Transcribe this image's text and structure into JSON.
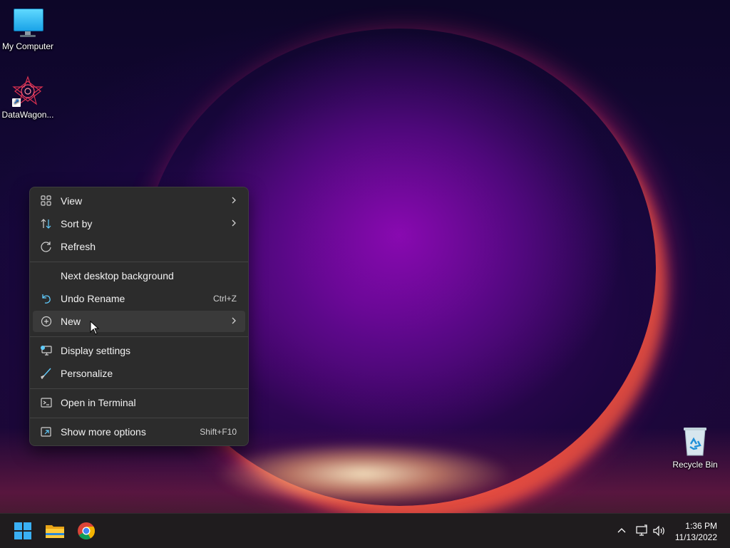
{
  "desktop": {
    "icons": [
      {
        "label": "My Computer"
      },
      {
        "label": "DataWagon..."
      },
      {
        "label": "Recycle Bin"
      }
    ]
  },
  "context_menu": {
    "items": [
      {
        "label": "View",
        "icon": "grid-icon",
        "submenu": true
      },
      {
        "label": "Sort by",
        "icon": "sort-icon",
        "submenu": true
      },
      {
        "label": "Refresh",
        "icon": "refresh-icon"
      },
      {
        "label": "Next desktop background"
      },
      {
        "label": "Undo Rename",
        "icon": "undo-icon",
        "shortcut": "Ctrl+Z"
      },
      {
        "label": "New",
        "icon": "new-plus-icon",
        "submenu": true,
        "highlighted": true
      },
      {
        "label": "Display settings",
        "icon": "display-settings-icon"
      },
      {
        "label": "Personalize",
        "icon": "brush-icon"
      },
      {
        "label": "Open in Terminal",
        "icon": "terminal-icon"
      },
      {
        "label": "Show more options",
        "icon": "more-options-icon",
        "shortcut": "Shift+F10"
      }
    ]
  },
  "taskbar": {
    "apps": [
      "start-icon",
      "file-explorer-icon",
      "chrome-icon"
    ],
    "clock": {
      "time": "1:36 PM",
      "date": "11/13/2022"
    }
  },
  "colors": {
    "menu_bg": "#2c2c2c",
    "accent": "#60cdff",
    "taskbar_bg": "#1f1c1e"
  }
}
